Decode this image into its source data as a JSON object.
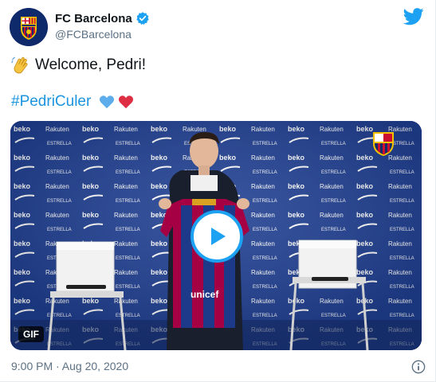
{
  "tweet": {
    "display_name": "FC Barcelona",
    "handle": "@FCBarcelona",
    "line1": "Welcome, Pedri!",
    "hashtag": "#PedriCuler",
    "timestamp": "9:00 PM · Aug 20, 2020"
  },
  "media": {
    "badge": "GIF",
    "backdrop_texts": [
      "beko",
      "Rakuten",
      "ESTRELLA DAMM",
      "unicef"
    ]
  },
  "colors": {
    "accent": "#1da1f2",
    "link": "#1b95e0",
    "secondary_text": "#5b7083",
    "backdrop": "#1d3d8f"
  },
  "icons": [
    "club-crest-icon",
    "verified-badge-icon",
    "twitter-bird-icon",
    "waving-hand-icon",
    "blue-heart-icon",
    "red-heart-icon",
    "play-icon",
    "info-icon"
  ]
}
